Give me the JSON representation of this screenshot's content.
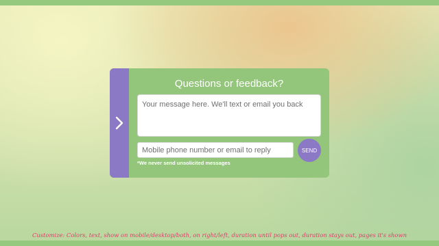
{
  "colors": {
    "accent_bar": "#94c97e",
    "panel_green": "#93c67a",
    "accent_purple": "#8b79c6",
    "caption_pink": "#d9406a"
  },
  "widget": {
    "toggle_icon": "chevron-right-icon",
    "title": "Questions or feedback?",
    "message_placeholder": "Your message here. We'll text or email you back",
    "contact_placeholder": "Mobile phone number or email to reply",
    "send_label": "SEND",
    "disclaimer": "*We never send unsolicited messages"
  },
  "caption": "Customize: Colors, text, show on mobile/desktop/both, on right/left, duration until pops out, duration stays out, pages it's shown"
}
